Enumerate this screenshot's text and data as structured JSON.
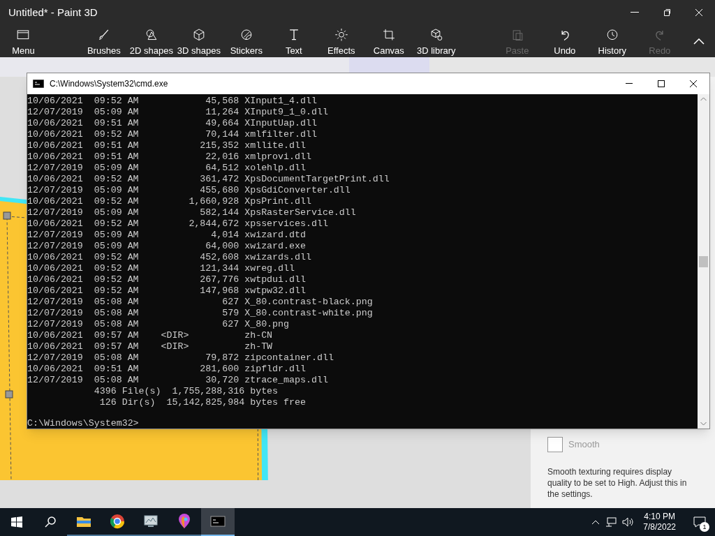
{
  "window": {
    "title": "Untitled* - Paint 3D"
  },
  "menu": {
    "label": "Menu"
  },
  "toolbar": [
    {
      "kind": "brush",
      "label": "Brushes",
      "disabled": false
    },
    {
      "kind": "shapes2d",
      "label": "2D shapes",
      "disabled": false
    },
    {
      "kind": "shapes3d",
      "label": "3D shapes",
      "disabled": false
    },
    {
      "kind": "stickers",
      "label": "Stickers",
      "disabled": false
    },
    {
      "kind": "text",
      "label": "Text",
      "disabled": false
    },
    {
      "kind": "effects",
      "label": "Effects",
      "disabled": false
    },
    {
      "kind": "canvas",
      "label": "Canvas",
      "disabled": false
    },
    {
      "kind": "library",
      "label": "3D library",
      "disabled": false
    }
  ],
  "actions": [
    {
      "kind": "paste",
      "label": "Paste",
      "disabled": true
    },
    {
      "kind": "undo",
      "label": "Undo",
      "disabled": false
    },
    {
      "kind": "history",
      "label": "History",
      "disabled": false
    },
    {
      "kind": "redo",
      "label": "Redo",
      "disabled": true
    }
  ],
  "console": {
    "title": "C:\\Windows\\System32\\cmd.exe",
    "lines": [
      "10/06/2021  09:52 AM            45,568 XInput1_4.dll",
      "12/07/2019  05:09 AM            11,264 XInput9_1_0.dll",
      "10/06/2021  09:51 AM            49,664 XInputUap.dll",
      "10/06/2021  09:52 AM            70,144 xmlfilter.dll",
      "10/06/2021  09:51 AM           215,352 xmllite.dll",
      "10/06/2021  09:51 AM            22,016 xmlprovi.dll",
      "12/07/2019  05:09 AM            64,512 xolehlp.dll",
      "10/06/2021  09:52 AM           361,472 XpsDocumentTargetPrint.dll",
      "12/07/2019  05:09 AM           455,680 XpsGdiConverter.dll",
      "10/06/2021  09:52 AM         1,660,928 XpsPrint.dll",
      "12/07/2019  05:09 AM           582,144 XpsRasterService.dll",
      "10/06/2021  09:52 AM         2,844,672 xpsservices.dll",
      "12/07/2019  05:09 AM             4,014 xwizard.dtd",
      "12/07/2019  05:09 AM            64,000 xwizard.exe",
      "10/06/2021  09:52 AM           452,608 xwizards.dll",
      "10/06/2021  09:52 AM           121,344 xwreg.dll",
      "10/06/2021  09:52 AM           267,776 xwtpdui.dll",
      "10/06/2021  09:52 AM           147,968 xwtpw32.dll",
      "12/07/2019  05:08 AM               627 X_80.contrast-black.png",
      "12/07/2019  05:08 AM               579 X_80.contrast-white.png",
      "12/07/2019  05:08 AM               627 X_80.png",
      "10/06/2021  09:57 AM    <DIR>          zh-CN",
      "10/06/2021  09:57 AM    <DIR>          zh-TW",
      "12/07/2019  05:08 AM            79,872 zipcontainer.dll",
      "10/06/2021  09:51 AM           281,600 zipfldr.dll",
      "12/07/2019  05:08 AM            30,720 ztrace_maps.dll",
      "            4396 File(s)  1,755,288,316 bytes",
      "             126 Dir(s)  15,142,825,984 bytes free"
    ],
    "prompt": "C:\\Windows\\System32>"
  },
  "panel": {
    "smooth": {
      "label": "Smooth",
      "checked": false
    },
    "note": "Smooth texturing requires display quality to be set to High. Adjust this in the settings."
  },
  "taskbar": {
    "apps": [
      {
        "kind": "folder",
        "selected": false
      },
      {
        "kind": "browser",
        "selected": false
      },
      {
        "kind": "monitor",
        "selected": false
      },
      {
        "kind": "paint",
        "selected": false
      },
      {
        "kind": "console",
        "selected": true
      }
    ],
    "time": "4:10 PM",
    "date": "7/8/2022",
    "notifications": "1"
  }
}
